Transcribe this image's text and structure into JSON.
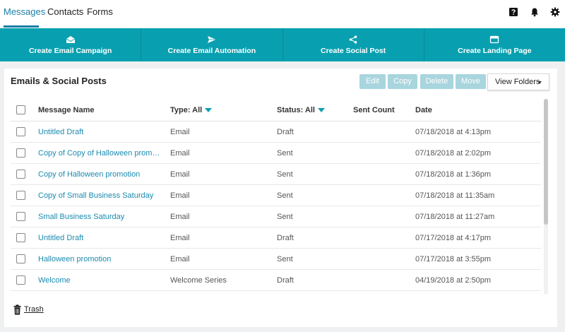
{
  "nav": {
    "tabs": [
      {
        "label": "Messages",
        "active": true
      },
      {
        "label": "Contacts",
        "active": false
      },
      {
        "label": "Forms",
        "active": false
      }
    ],
    "icons": [
      "help-icon",
      "bell-icon",
      "gear-icon"
    ]
  },
  "actions": [
    {
      "label": "Create Email Campaign",
      "icon": "envelope-open-icon"
    },
    {
      "label": "Create Email Automation",
      "icon": "paper-plane-icon"
    },
    {
      "label": "Create Social Post",
      "icon": "share-icon"
    },
    {
      "label": "Create Landing Page",
      "icon": "browser-window-icon"
    }
  ],
  "panel": {
    "title": "Emails & Social Posts",
    "buttons": {
      "edit": "Edit",
      "copy": "Copy",
      "delete": "Delete",
      "move": "Move"
    },
    "view_folders": "View Folders"
  },
  "table": {
    "headers": {
      "name": "Message Name",
      "type": "Type: All",
      "status": "Status: All",
      "sent": "Sent Count",
      "date": "Date"
    },
    "rows": [
      {
        "name": "Untitled Draft",
        "type": "Email",
        "status": "Draft",
        "sent": "",
        "date": "07/18/2018 at 4:13pm"
      },
      {
        "name": "Copy of Copy of Halloween promot…",
        "type": "Email",
        "status": "Sent",
        "sent": "",
        "date": "07/18/2018 at 2:02pm"
      },
      {
        "name": "Copy of Halloween promotion",
        "type": "Email",
        "status": "Sent",
        "sent": "",
        "date": "07/18/2018 at 1:36pm"
      },
      {
        "name": "Copy of Small Business Saturday",
        "type": "Email",
        "status": "Sent",
        "sent": "",
        "date": "07/18/2018 at 11:35am"
      },
      {
        "name": "Small Business Saturday",
        "type": "Email",
        "status": "Sent",
        "sent": "",
        "date": "07/18/2018 at 11:27am"
      },
      {
        "name": "Untitled Draft",
        "type": "Email",
        "status": "Draft",
        "sent": "",
        "date": "07/17/2018 at 4:17pm"
      },
      {
        "name": "Halloween promotion",
        "type": "Email",
        "status": "Sent",
        "sent": "",
        "date": "07/17/2018 at 3:55pm"
      },
      {
        "name": "Welcome",
        "type": "Welcome Series",
        "status": "Draft",
        "sent": "",
        "date": "04/19/2018 at 2:50pm"
      }
    ]
  },
  "footer": {
    "trash_label": "Trash"
  },
  "colors": {
    "accent": "#08a0b0",
    "link": "#1a8bb0",
    "disabled_button": "#a8d5de"
  }
}
